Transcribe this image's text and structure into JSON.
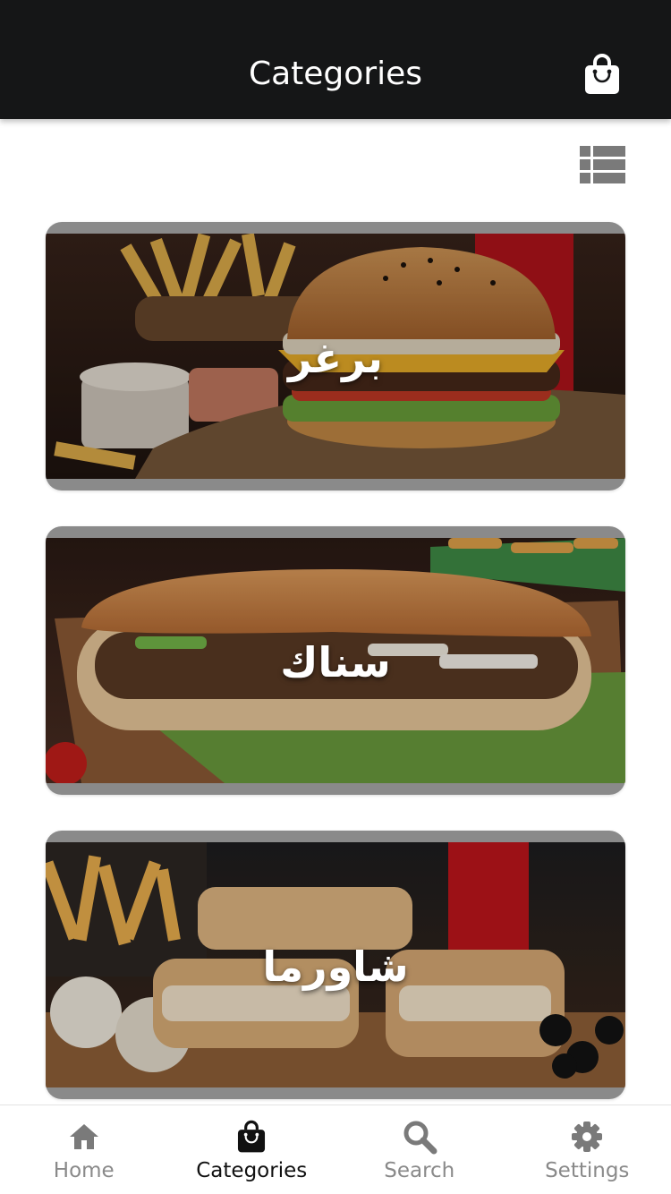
{
  "header": {
    "title": "Categories",
    "cart_icon": "shopping-bag-icon"
  },
  "toolbar": {
    "view_toggle_icon": "list-view-icon"
  },
  "categories": [
    {
      "label": "برغر",
      "image": "burger-photo"
    },
    {
      "label": "سناك",
      "image": "sub-sandwich-photo"
    },
    {
      "label": "شاورما",
      "image": "shawarma-photo"
    }
  ],
  "tabbar": {
    "items": [
      {
        "label": "Home",
        "icon": "home-icon",
        "active": false
      },
      {
        "label": "Categories",
        "icon": "shopping-bag-icon",
        "active": true
      },
      {
        "label": "Search",
        "icon": "search-icon",
        "active": false
      },
      {
        "label": "Settings",
        "icon": "gear-icon",
        "active": false
      }
    ]
  },
  "colors": {
    "header_bg": "#151617",
    "active_tab": "#111111",
    "inactive_tab": "#8a8a8a"
  }
}
